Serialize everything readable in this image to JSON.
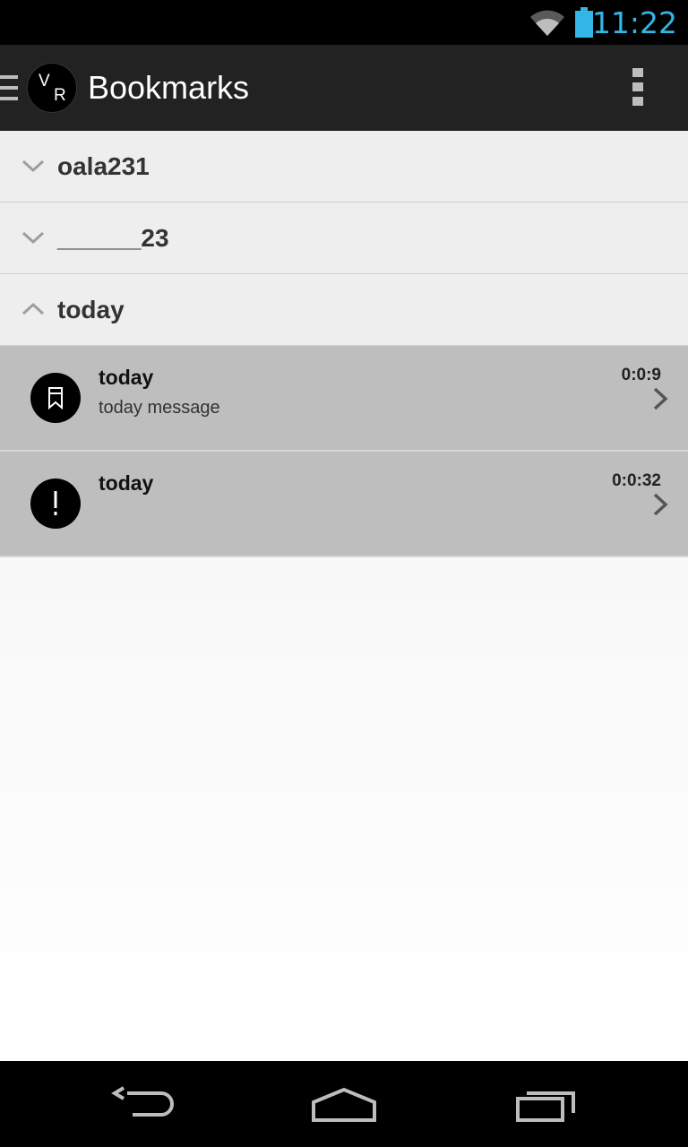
{
  "status_bar": {
    "time": "11:22",
    "icons": [
      "wifi-icon",
      "battery-icon"
    ],
    "time_color": "#33b5e5"
  },
  "action_bar": {
    "logo_letters": [
      "V",
      "R"
    ],
    "title": "Bookmarks",
    "icons": [
      "drawer-icon",
      "overflow-menu-icon"
    ]
  },
  "groups": [
    {
      "label": "oala231",
      "state": "collapsed"
    },
    {
      "label": "______23",
      "state": "collapsed"
    },
    {
      "label": "today",
      "state": "expanded",
      "items": [
        {
          "title": "today",
          "subtitle": "today message",
          "duration": "0:0:9",
          "icon": "bookmark-icon"
        },
        {
          "title": "today",
          "subtitle": "",
          "duration": "0:0:32",
          "icon": "exclamation-icon"
        }
      ]
    }
  ],
  "nav_bar": {
    "buttons": [
      "back-icon",
      "home-icon",
      "recent-apps-icon"
    ]
  }
}
